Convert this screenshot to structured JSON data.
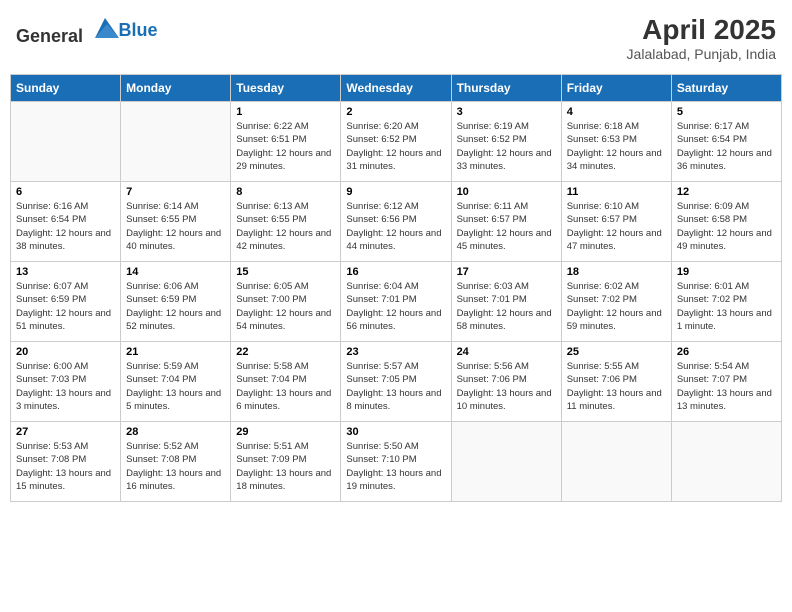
{
  "header": {
    "logo_general": "General",
    "logo_blue": "Blue",
    "month_year": "April 2025",
    "location": "Jalalabad, Punjab, India"
  },
  "days_of_week": [
    "Sunday",
    "Monday",
    "Tuesday",
    "Wednesday",
    "Thursday",
    "Friday",
    "Saturday"
  ],
  "weeks": [
    [
      {
        "day": "",
        "info": ""
      },
      {
        "day": "",
        "info": ""
      },
      {
        "day": "1",
        "info": "Sunrise: 6:22 AM\nSunset: 6:51 PM\nDaylight: 12 hours and 29 minutes."
      },
      {
        "day": "2",
        "info": "Sunrise: 6:20 AM\nSunset: 6:52 PM\nDaylight: 12 hours and 31 minutes."
      },
      {
        "day": "3",
        "info": "Sunrise: 6:19 AM\nSunset: 6:52 PM\nDaylight: 12 hours and 33 minutes."
      },
      {
        "day": "4",
        "info": "Sunrise: 6:18 AM\nSunset: 6:53 PM\nDaylight: 12 hours and 34 minutes."
      },
      {
        "day": "5",
        "info": "Sunrise: 6:17 AM\nSunset: 6:54 PM\nDaylight: 12 hours and 36 minutes."
      }
    ],
    [
      {
        "day": "6",
        "info": "Sunrise: 6:16 AM\nSunset: 6:54 PM\nDaylight: 12 hours and 38 minutes."
      },
      {
        "day": "7",
        "info": "Sunrise: 6:14 AM\nSunset: 6:55 PM\nDaylight: 12 hours and 40 minutes."
      },
      {
        "day": "8",
        "info": "Sunrise: 6:13 AM\nSunset: 6:55 PM\nDaylight: 12 hours and 42 minutes."
      },
      {
        "day": "9",
        "info": "Sunrise: 6:12 AM\nSunset: 6:56 PM\nDaylight: 12 hours and 44 minutes."
      },
      {
        "day": "10",
        "info": "Sunrise: 6:11 AM\nSunset: 6:57 PM\nDaylight: 12 hours and 45 minutes."
      },
      {
        "day": "11",
        "info": "Sunrise: 6:10 AM\nSunset: 6:57 PM\nDaylight: 12 hours and 47 minutes."
      },
      {
        "day": "12",
        "info": "Sunrise: 6:09 AM\nSunset: 6:58 PM\nDaylight: 12 hours and 49 minutes."
      }
    ],
    [
      {
        "day": "13",
        "info": "Sunrise: 6:07 AM\nSunset: 6:59 PM\nDaylight: 12 hours and 51 minutes."
      },
      {
        "day": "14",
        "info": "Sunrise: 6:06 AM\nSunset: 6:59 PM\nDaylight: 12 hours and 52 minutes."
      },
      {
        "day": "15",
        "info": "Sunrise: 6:05 AM\nSunset: 7:00 PM\nDaylight: 12 hours and 54 minutes."
      },
      {
        "day": "16",
        "info": "Sunrise: 6:04 AM\nSunset: 7:01 PM\nDaylight: 12 hours and 56 minutes."
      },
      {
        "day": "17",
        "info": "Sunrise: 6:03 AM\nSunset: 7:01 PM\nDaylight: 12 hours and 58 minutes."
      },
      {
        "day": "18",
        "info": "Sunrise: 6:02 AM\nSunset: 7:02 PM\nDaylight: 12 hours and 59 minutes."
      },
      {
        "day": "19",
        "info": "Sunrise: 6:01 AM\nSunset: 7:02 PM\nDaylight: 13 hours and 1 minute."
      }
    ],
    [
      {
        "day": "20",
        "info": "Sunrise: 6:00 AM\nSunset: 7:03 PM\nDaylight: 13 hours and 3 minutes."
      },
      {
        "day": "21",
        "info": "Sunrise: 5:59 AM\nSunset: 7:04 PM\nDaylight: 13 hours and 5 minutes."
      },
      {
        "day": "22",
        "info": "Sunrise: 5:58 AM\nSunset: 7:04 PM\nDaylight: 13 hours and 6 minutes."
      },
      {
        "day": "23",
        "info": "Sunrise: 5:57 AM\nSunset: 7:05 PM\nDaylight: 13 hours and 8 minutes."
      },
      {
        "day": "24",
        "info": "Sunrise: 5:56 AM\nSunset: 7:06 PM\nDaylight: 13 hours and 10 minutes."
      },
      {
        "day": "25",
        "info": "Sunrise: 5:55 AM\nSunset: 7:06 PM\nDaylight: 13 hours and 11 minutes."
      },
      {
        "day": "26",
        "info": "Sunrise: 5:54 AM\nSunset: 7:07 PM\nDaylight: 13 hours and 13 minutes."
      }
    ],
    [
      {
        "day": "27",
        "info": "Sunrise: 5:53 AM\nSunset: 7:08 PM\nDaylight: 13 hours and 15 minutes."
      },
      {
        "day": "28",
        "info": "Sunrise: 5:52 AM\nSunset: 7:08 PM\nDaylight: 13 hours and 16 minutes."
      },
      {
        "day": "29",
        "info": "Sunrise: 5:51 AM\nSunset: 7:09 PM\nDaylight: 13 hours and 18 minutes."
      },
      {
        "day": "30",
        "info": "Sunrise: 5:50 AM\nSunset: 7:10 PM\nDaylight: 13 hours and 19 minutes."
      },
      {
        "day": "",
        "info": ""
      },
      {
        "day": "",
        "info": ""
      },
      {
        "day": "",
        "info": ""
      }
    ]
  ]
}
